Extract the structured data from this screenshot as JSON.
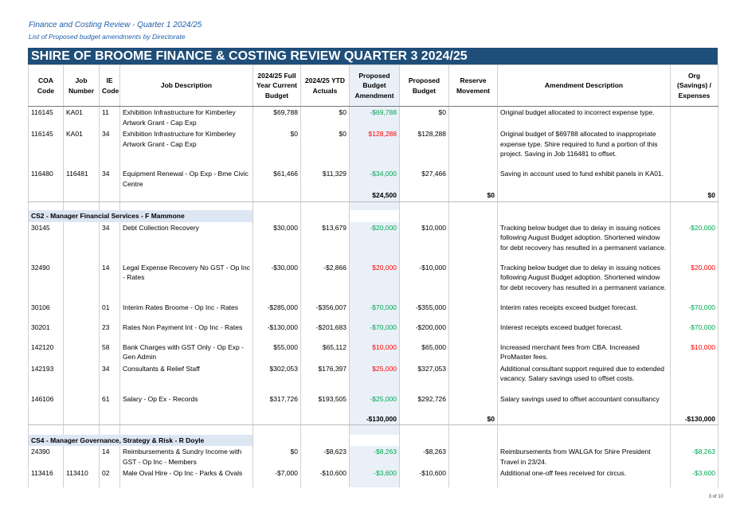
{
  "header": {
    "title": "Finance and Costing Review - Quarter 1 2024/25",
    "subtitle": "List of Proposed budget amendments by Directorate"
  },
  "banner": "SHIRE OF BROOME FINANCE & COSTING REVIEW QUARTER 3  2024/25",
  "columns": {
    "coa": "COA Code",
    "job": "Job Number",
    "ie": "IE Code",
    "desc": "Job Description",
    "budget": "2024/25 Full Year Current Budget",
    "ytd": "2024/25 YTD Actuals",
    "amend": "Proposed Budget Amendment",
    "proposed": "Proposed Budget",
    "reserve": "Reserve Movement",
    "amenddesc": "Amendment Description",
    "org": "Org (Savings) / Expenses"
  },
  "rows": [
    {
      "coa": "116145",
      "job": "KA01",
      "ie": "11",
      "desc": "Exhibition Infrastructure for Kimberley Artwork Grant - Cap Exp",
      "budget": "$69,788",
      "ytd": "$0",
      "amend": "-$69,788",
      "amendSign": "neg",
      "proposed": "$0",
      "reserve": "",
      "amenddesc": "Original budget allocated to incorrect expense type.",
      "org": "",
      "orgSign": ""
    },
    {
      "coa": "116145",
      "job": "KA01",
      "ie": "34",
      "desc": "Exhibition Infrastructure for Kimberley Artwork Grant - Cap Exp",
      "budget": "$0",
      "ytd": "$0",
      "amend": "$128,288",
      "amendSign": "pos",
      "proposed": "$128,288",
      "reserve": "",
      "amenddesc": "Original budget of $69788 allocated to inappropriate expense type. Shire required to fund a portion of this project. Saving in Job 116481 to offset.",
      "org": "",
      "orgSign": ""
    },
    {
      "coa": "116480",
      "job": "116481",
      "ie": "34",
      "desc": "Equipment Renewal - Op Exp - Bme Civic Centre",
      "budget": "$61,466",
      "ytd": "$11,329",
      "amend": "-$34,000",
      "amendSign": "neg",
      "proposed": "$27,466",
      "reserve": "",
      "amenddesc": "Saving in account used to fund exhibit panels in KA01.",
      "org": "",
      "orgSign": ""
    }
  ],
  "total1": {
    "amend": "$24,500",
    "reserve": "$0",
    "org": "$0"
  },
  "section2": {
    "title": "CS2 - Manager Financial Services - F Mammone",
    "rows": [
      {
        "coa": "30145",
        "job": "",
        "ie": "34",
        "desc": "Debt Collection Recovery",
        "budget": "$30,000",
        "ytd": "$13,679",
        "amend": "-$20,000",
        "amendSign": "neg",
        "proposed": "$10,000",
        "reserve": "",
        "amenddesc": "Tracking below budget due to delay in issuing notices following August Budget adoption. Shortened window for debt recovery has resulted in a permanent variance.",
        "org": "-$20,000",
        "orgSign": "neg"
      },
      {
        "coa": "32490",
        "job": "",
        "ie": "14",
        "desc": "Legal Expense Recovery No GST - Op Inc - Rates",
        "budget": "-$30,000",
        "ytd": "-$2,866",
        "amend": "$20,000",
        "amendSign": "pos",
        "proposed": "-$10,000",
        "reserve": "",
        "amenddesc": "Tracking below budget due to delay in issuing notices following August Budget adoption. Shortened window for debt recovery has resulted in a permanent variance.",
        "org": "$20,000",
        "orgSign": "pos"
      },
      {
        "coa": "30106",
        "job": "",
        "ie": "01",
        "desc": "Interim Rates Broome - Op Inc - Rates",
        "budget": "-$285,000",
        "ytd": "-$356,007",
        "amend": "-$70,000",
        "amendSign": "neg",
        "proposed": "-$355,000",
        "reserve": "",
        "amenddesc": "Interim rates receipts exceed budget forecast.",
        "org": "-$70,000",
        "orgSign": "neg"
      },
      {
        "coa": "30201",
        "job": "",
        "ie": "23",
        "desc": "Rates Non Payment Int - Op Inc - Rates",
        "budget": "-$130,000",
        "ytd": "-$201,683",
        "amend": "-$70,000",
        "amendSign": "neg",
        "proposed": "-$200,000",
        "reserve": "",
        "amenddesc": "Interest receipts exceed budget forecast.",
        "org": "-$70,000",
        "orgSign": "neg"
      },
      {
        "coa": "142120",
        "job": "",
        "ie": "58",
        "desc": "Bank Charges with GST Only - Op Exp - Gen Admin",
        "budget": "$55,000",
        "ytd": "$65,112",
        "amend": "$10,000",
        "amendSign": "pos",
        "proposed": "$65,000",
        "reserve": "",
        "amenddesc": "Increased merchant fees from CBA. Increased ProMaster fees.",
        "org": "$10,000",
        "orgSign": "pos"
      },
      {
        "coa": "142193",
        "job": "",
        "ie": "34",
        "desc": "Consultants & Relief Staff",
        "budget": "$302,053",
        "ytd": "$176,397",
        "amend": "$25,000",
        "amendSign": "pos",
        "proposed": "$327,053",
        "reserve": "",
        "amenddesc": "Additional consultant support required due to extended vacancy. Salary savings used to offset costs.",
        "org": "",
        "orgSign": ""
      },
      {
        "coa": "146106",
        "job": "",
        "ie": "61",
        "desc": "Salary - Op Ex - Records",
        "budget": "$317,726",
        "ytd": "$193,505",
        "amend": "-$25,000",
        "amendSign": "neg",
        "proposed": "$292,726",
        "reserve": "",
        "amenddesc": "Salary savings used to offset accountant consultancy",
        "org": "",
        "orgSign": ""
      }
    ],
    "total": {
      "amend": "-$130,000",
      "reserve": "$0",
      "org": "-$130,000"
    }
  },
  "section3": {
    "title": "CS4 - Manager Governance, Strategy & Risk - R Doyle",
    "rows": [
      {
        "coa": "24390",
        "job": "",
        "ie": "14",
        "desc": "Reimbursements & Sundry Income with GST - Op Inc - Members",
        "budget": "$0",
        "ytd": "-$8,623",
        "amend": "-$8,263",
        "amendSign": "neg",
        "proposed": "-$8,263",
        "reserve": "",
        "amenddesc": "Reimbursements from WALGA for Shire President Travel in 23/24.",
        "org": "-$8,263",
        "orgSign": "neg"
      },
      {
        "coa": "113416",
        "job": "113410",
        "ie": "02",
        "desc": "Male Oval Hire - Op Inc - Parks & Ovals",
        "budget": "-$7,000",
        "ytd": "-$10,600",
        "amend": "-$3,600",
        "amendSign": "neg",
        "proposed": "-$10,600",
        "reserve": "",
        "amenddesc": "Additional one-off fees received for circus.",
        "org": "-$3,600",
        "orgSign": "neg"
      }
    ]
  },
  "page_number": "3 of 10"
}
